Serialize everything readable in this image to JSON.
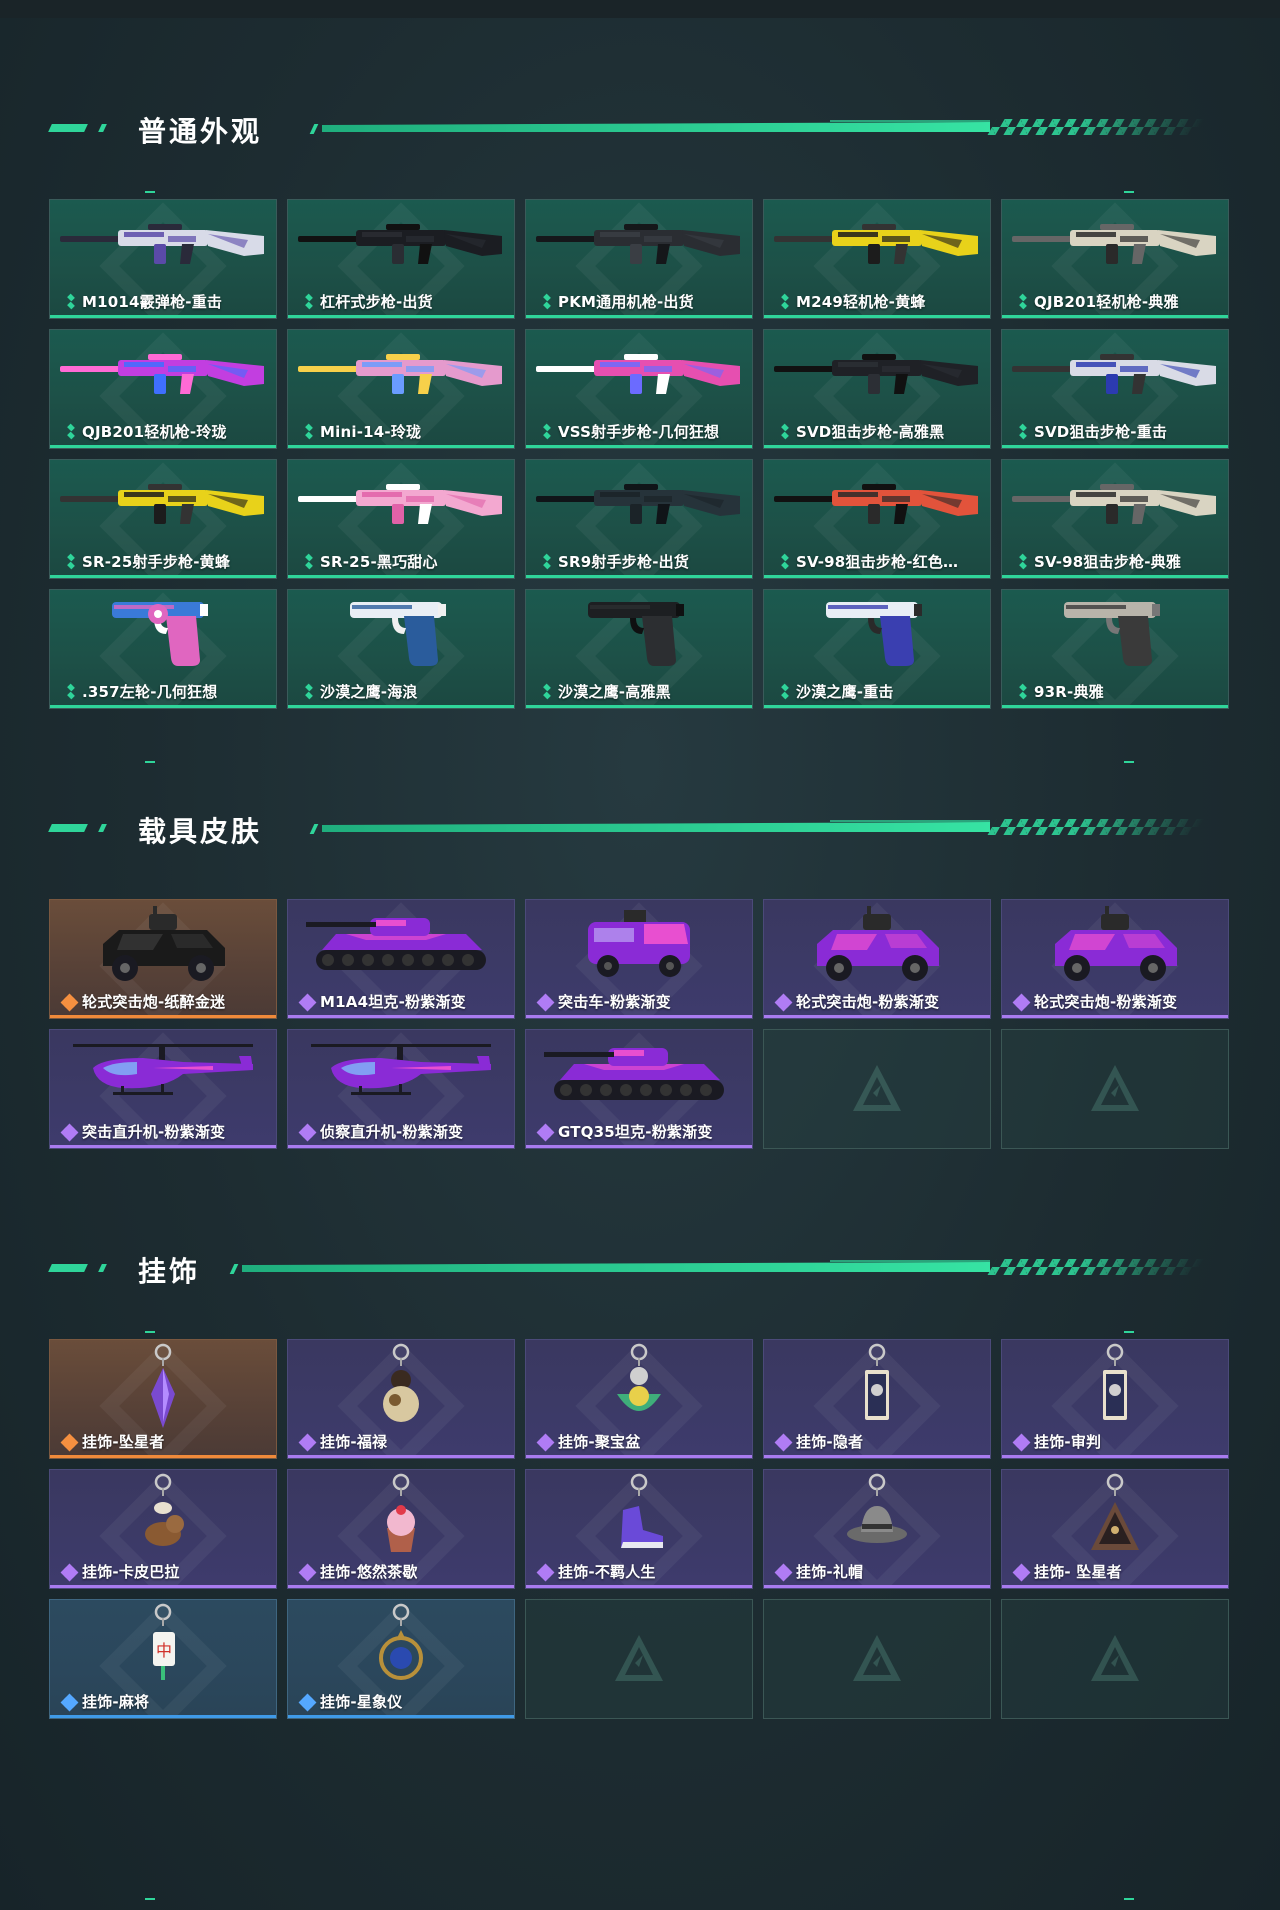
{
  "sections": [
    {
      "title": "普通外观"
    },
    {
      "title": "载具皮肤"
    },
    {
      "title": "挂饰"
    }
  ],
  "weapons": [
    {
      "name": "M1014霰弹枪-重击",
      "rarity": "green",
      "icon": "shotgun-icon"
    },
    {
      "name": "杠杆式步枪-出货",
      "rarity": "green",
      "icon": "lever-rifle-icon"
    },
    {
      "name": "PKM通用机枪-出货",
      "rarity": "green",
      "icon": "machine-gun-icon"
    },
    {
      "name": "M249轻机枪-黄蜂",
      "rarity": "green",
      "icon": "light-machine-gun-icon"
    },
    {
      "name": "QJB201轻机枪-典雅",
      "rarity": "green",
      "icon": "light-machine-gun-icon"
    },
    {
      "name": "QJB201轻机枪-玲珑",
      "rarity": "green",
      "icon": "light-machine-gun-icon"
    },
    {
      "name": "Mini-14-玲珑",
      "rarity": "green",
      "icon": "rifle-icon"
    },
    {
      "name": "VSS射手步枪-几何狂想",
      "rarity": "green",
      "icon": "marksman-rifle-icon"
    },
    {
      "name": "SVD狙击步枪-高雅黑",
      "rarity": "green",
      "icon": "sniper-rifle-icon"
    },
    {
      "name": "SVD狙击步枪-重击",
      "rarity": "green",
      "icon": "sniper-rifle-icon"
    },
    {
      "name": "SR-25射手步枪-黄蜂",
      "rarity": "green",
      "icon": "marksman-rifle-icon"
    },
    {
      "name": "SR-25-黑巧甜心",
      "rarity": "green",
      "icon": "marksman-rifle-icon"
    },
    {
      "name": "SR9射手步枪-出货",
      "rarity": "green",
      "icon": "marksman-rifle-icon"
    },
    {
      "name": "SV-98狙击步枪-红色…",
      "rarity": "green",
      "icon": "sniper-rifle-icon"
    },
    {
      "name": "SV-98狙击步枪-典雅",
      "rarity": "green",
      "icon": "sniper-rifle-icon"
    },
    {
      "name": ".357左轮-几何狂想",
      "rarity": "green",
      "icon": "revolver-icon"
    },
    {
      "name": "沙漠之鹰-海浪",
      "rarity": "green",
      "icon": "pistol-icon"
    },
    {
      "name": "沙漠之鹰-高雅黑",
      "rarity": "green",
      "icon": "pistol-icon"
    },
    {
      "name": "沙漠之鹰-重击",
      "rarity": "green",
      "icon": "pistol-icon"
    },
    {
      "name": "93R-典雅",
      "rarity": "green",
      "icon": "pistol-icon"
    }
  ],
  "vehicles": [
    {
      "name": "轮式突击炮-纸醉金迷",
      "rarity": "orange",
      "icon": "armored-car-icon"
    },
    {
      "name": "M1A4坦克-粉紫渐变",
      "rarity": "purple",
      "icon": "tank-icon"
    },
    {
      "name": "突击车-粉紫渐变",
      "rarity": "purple",
      "icon": "armored-truck-icon"
    },
    {
      "name": "轮式突击炮-粉紫渐变",
      "rarity": "purple",
      "icon": "armored-car-icon"
    },
    {
      "name": "轮式突击炮-粉紫渐变",
      "rarity": "purple",
      "icon": "armored-car-icon"
    },
    {
      "name": "突击直升机-粉紫渐变",
      "rarity": "purple",
      "icon": "attack-helicopter-icon"
    },
    {
      "name": "侦察直升机-粉紫渐变",
      "rarity": "purple",
      "icon": "scout-helicopter-icon"
    },
    {
      "name": "GTQ35坦克-粉紫渐变",
      "rarity": "purple",
      "icon": "tank-icon"
    }
  ],
  "charms": [
    {
      "name": "挂饰-坠星者",
      "rarity": "orange",
      "icon": "crystal-charm-icon"
    },
    {
      "name": "挂饰-福禄",
      "rarity": "purple",
      "icon": "gourd-charm-icon"
    },
    {
      "name": "挂饰-聚宝盆",
      "rarity": "purple",
      "icon": "treasure-bowl-charm-icon"
    },
    {
      "name": "挂饰-隐者",
      "rarity": "purple",
      "icon": "card-charm-icon"
    },
    {
      "name": "挂饰-审判",
      "rarity": "purple",
      "icon": "card-charm-icon"
    },
    {
      "name": "挂饰-卡皮巴拉",
      "rarity": "purple",
      "icon": "capybara-charm-icon"
    },
    {
      "name": "挂饰-悠然茶歇",
      "rarity": "purple",
      "icon": "cupcake-charm-icon"
    },
    {
      "name": "挂饰-不羁人生",
      "rarity": "purple",
      "icon": "sneaker-charm-icon"
    },
    {
      "name": "挂饰-礼帽",
      "rarity": "purple",
      "icon": "hat-charm-icon"
    },
    {
      "name": "挂饰- 坠星者",
      "rarity": "purple",
      "icon": "triangle-charm-icon"
    },
    {
      "name": "挂饰-麻将",
      "rarity": "blue",
      "icon": "mahjong-charm-icon"
    },
    {
      "name": "挂饰-星象仪",
      "rarity": "blue",
      "icon": "astrolabe-charm-icon"
    }
  ],
  "colors": {
    "accent_green": "#2fd59a",
    "rarity_purple": "#a97bf0",
    "rarity_orange": "#f08a3a",
    "rarity_blue": "#3f9ae8"
  }
}
